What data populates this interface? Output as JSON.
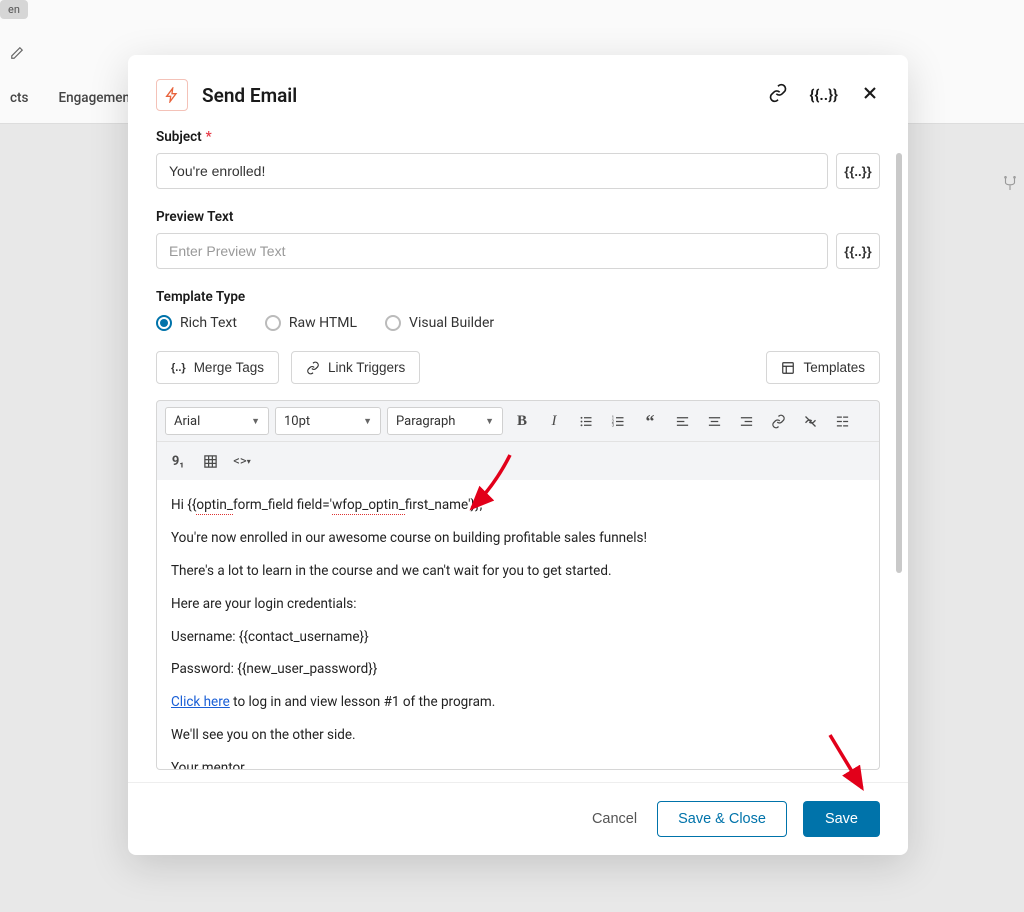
{
  "bg": {
    "badge": "en",
    "nav1": "cts",
    "nav2": "Engagemen"
  },
  "modal": {
    "title": "Send Email"
  },
  "subject": {
    "label": "Subject",
    "value": "You're enrolled!"
  },
  "preview": {
    "label": "Preview Text",
    "placeholder": "Enter Preview Text"
  },
  "template_type": {
    "label": "Template Type",
    "opt1": "Rich Text",
    "opt2": "Raw HTML",
    "opt3": "Visual Builder"
  },
  "btns": {
    "merge_tags": "Merge Tags",
    "link_triggers": "Link Triggers",
    "templates": "Templates",
    "merge_sym": "{{..}}"
  },
  "toolbar": {
    "font": "Arial",
    "size": "10pt",
    "block": "Paragraph"
  },
  "body": {
    "greet_pre": "Hi {{",
    "greet_spell": "optin_",
    "greet_mid": "form_field field='",
    "greet_spell2": "wfop_optin_",
    "greet_post": "first_name'}},",
    "l2": "You're now enrolled in our awesome course on building profitable sales funnels!",
    "l3": "There's a lot to learn in the course and we can't wait for you to get started.",
    "l4": "Here are your login credentials:",
    "l5": "Username: {{contact_username}}",
    "l6": "Password: {{new_user_password}}",
    "l7a": "Click here",
    "l7b": " to log in and view lesson #1 of the program.",
    "l8": "We'll see you on the other side.",
    "l9": "Your mentor"
  },
  "footer": {
    "cancel": "Cancel",
    "save_close": "Save & Close",
    "save": "Save"
  }
}
